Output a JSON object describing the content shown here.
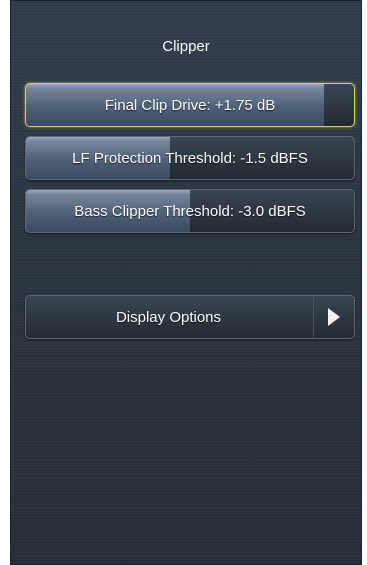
{
  "screen": {
    "title": "Clipper"
  },
  "controls": [
    {
      "label": "Final Clip Drive: +1.75 dB",
      "value": "+1.75 dB",
      "fill_fraction": 0.91,
      "selected": true
    },
    {
      "label": "LF Protection Threshold: -1.5 dBFS",
      "value": "-1.5 dBFS",
      "fill_fraction": 0.44,
      "selected": false
    },
    {
      "label": "Bass Clipper Threshold: -3.0 dBFS",
      "value": "-3.0 dBFS",
      "fill_fraction": 0.5,
      "selected": false
    }
  ],
  "display_options": {
    "label": "Display Options",
    "icon": "chevron-right-icon"
  },
  "colors": {
    "selected_border": "#ddd05a",
    "background": "#2c3643"
  }
}
